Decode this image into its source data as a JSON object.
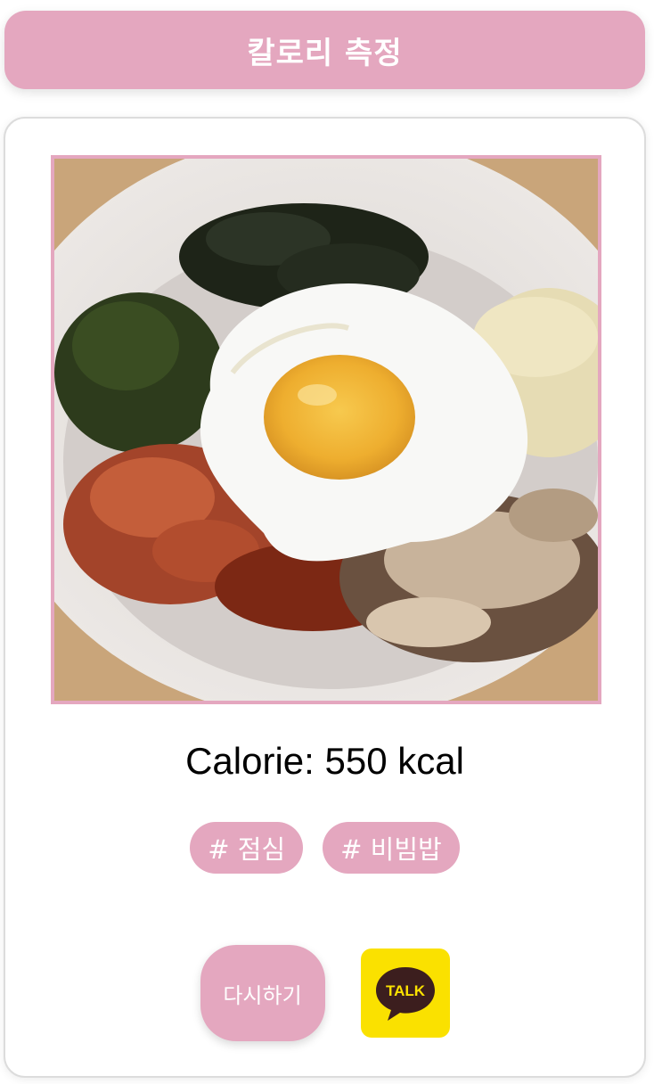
{
  "header": {
    "title": "칼로리 측정"
  },
  "result": {
    "image_alt": "bibimbap with fried egg",
    "calorie_text": "Calorie: 550 kcal"
  },
  "tags": [
    {
      "label": "# 점심"
    },
    {
      "label": "# 비빔밥"
    }
  ],
  "actions": {
    "retry_label": "다시하기",
    "kakao_label": "TALK"
  },
  "colors": {
    "accent": "#e4a7bf",
    "kakao_yellow": "#fae100",
    "kakao_brown": "#3c1e1e"
  }
}
